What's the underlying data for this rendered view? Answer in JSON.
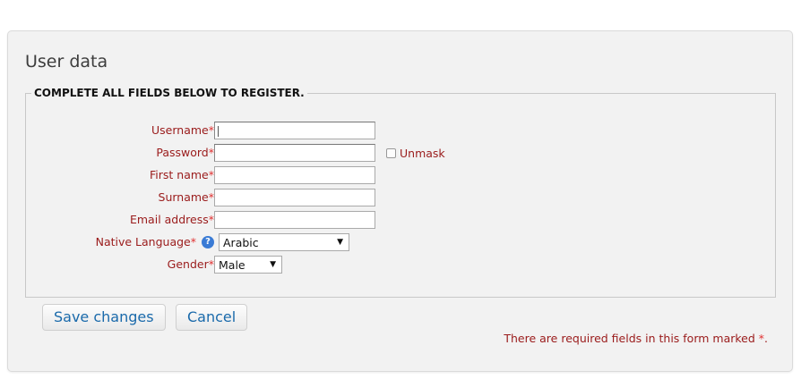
{
  "panel": {
    "title": "User data",
    "legend": "COMPLETE ALL FIELDS BELOW TO REGISTER."
  },
  "fields": {
    "required_marker": "*",
    "username": {
      "label": "Username",
      "value": ""
    },
    "password": {
      "label": "Password",
      "value": ""
    },
    "unmask_label": "Unmask",
    "first_name": {
      "label": "First name",
      "value": ""
    },
    "surname": {
      "label": "Surname",
      "value": ""
    },
    "email": {
      "label": "Email address",
      "value": ""
    },
    "native_language": {
      "label": "Native Language",
      "selected": "Arabic"
    },
    "gender": {
      "label": "Gender",
      "selected": "Male"
    }
  },
  "buttons": {
    "save": "Save changes",
    "cancel": "Cancel"
  },
  "footer_note": {
    "text": "There are required fields in this form marked ",
    "marker": "*",
    "end": "."
  },
  "icons": {
    "help": "help-question-icon",
    "dropdown": "chevron-down-icon",
    "checkbox": "checkbox-icon"
  },
  "colors": {
    "label_red": "#9a1b1b",
    "required_red": "#e03131",
    "link_blue": "#1a6aab",
    "help_blue": "#3a7bd5"
  }
}
